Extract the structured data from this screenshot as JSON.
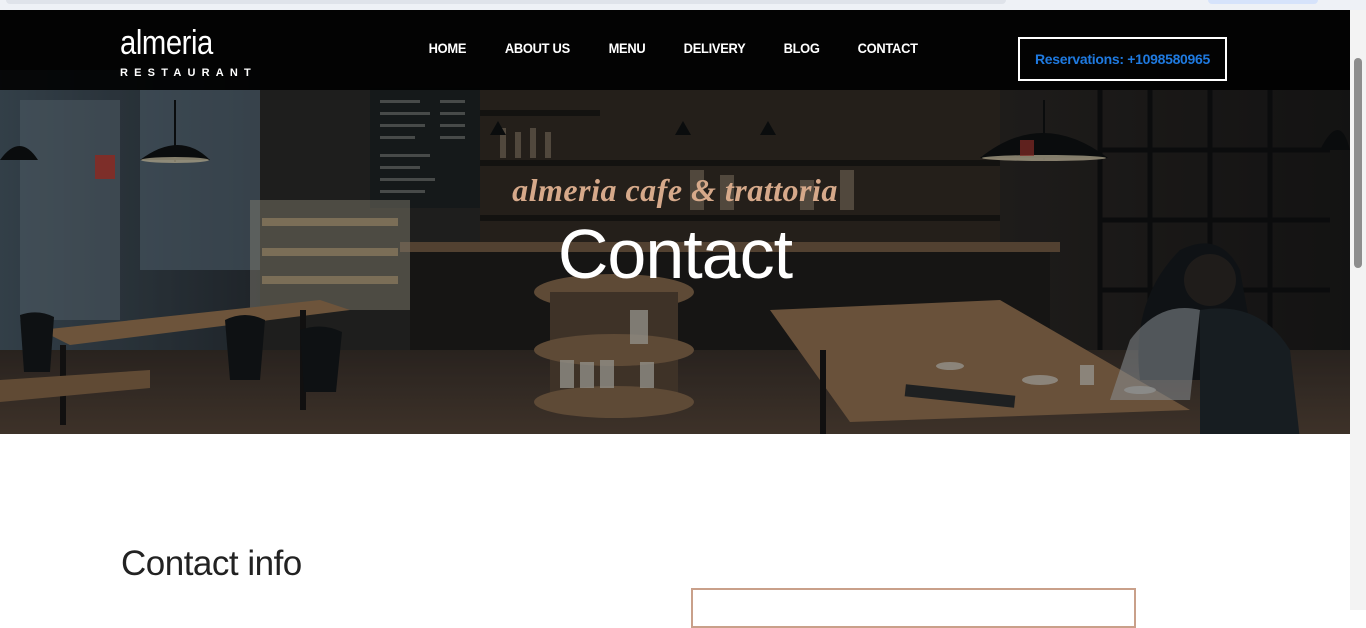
{
  "brand": {
    "name": "almeria",
    "subtitle": "RESTAURANT"
  },
  "nav": {
    "items": [
      {
        "label": "HOME"
      },
      {
        "label": "ABOUT US"
      },
      {
        "label": "MENU"
      },
      {
        "label": "DELIVERY"
      },
      {
        "label": "BLOG"
      },
      {
        "label": "CONTACT"
      }
    ],
    "reservation_label": "Reservations: +1098580965"
  },
  "hero": {
    "tagline": "almeria cafe & trattoria",
    "title": "Contact"
  },
  "contact": {
    "heading": "Contact info"
  },
  "colors": {
    "accent": "#1f7ae0",
    "tagline": "#d6a98a",
    "form_border": "#c9a08a",
    "navbar": "#000000"
  }
}
